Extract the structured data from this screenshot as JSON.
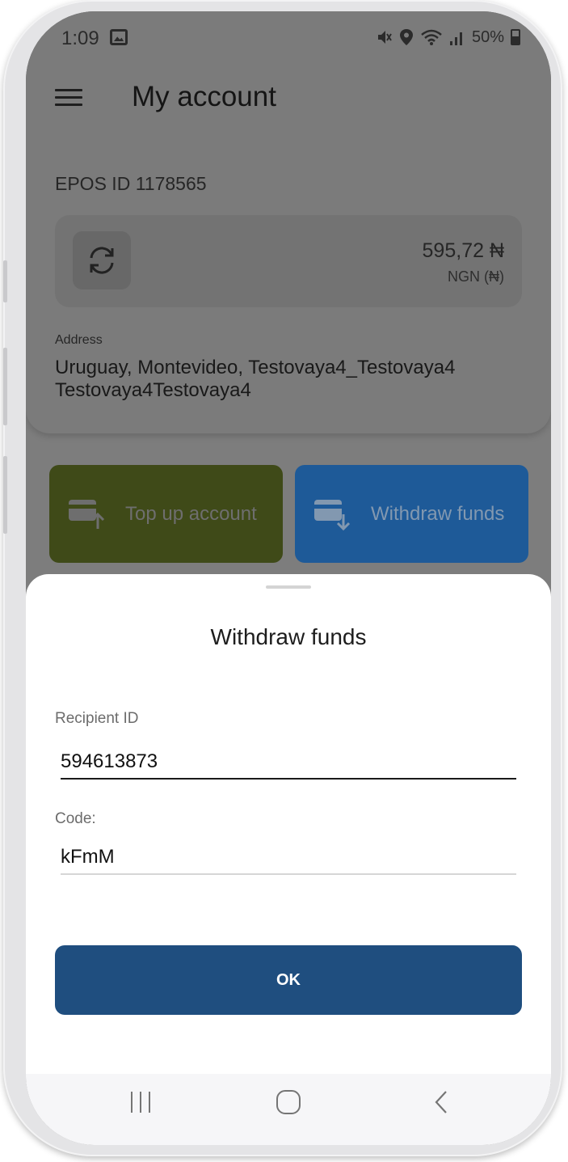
{
  "status_bar": {
    "time": "1:09",
    "battery": "50%",
    "icons": [
      "gallery-icon",
      "mute-icon",
      "location-icon",
      "wifi-icon",
      "signal-icon",
      "battery-icon"
    ]
  },
  "appbar": {
    "title": "My account",
    "menu_icon": "menu-icon"
  },
  "account": {
    "epos_id": "EPOS ID 1178565",
    "balance": "595,72 ₦",
    "currency": "NGN (₦)",
    "address_label": "Address",
    "address": "Uruguay, Montevideo, Testovaya4_Testovaya4 Testovaya4Testovaya4"
  },
  "actions": {
    "top_up": "Top up account",
    "withdraw": "Withdraw funds"
  },
  "sheet": {
    "title": "Withdraw funds",
    "recipient_label": "Recipient ID",
    "recipient_value": "594613873",
    "code_label": "Code:",
    "code_value": "kFmM",
    "ok_label": "OK"
  },
  "colors": {
    "top_up_button": "#3f4a18",
    "withdraw_button": "#1e5a98",
    "ok_button": "#1f4e7f"
  }
}
